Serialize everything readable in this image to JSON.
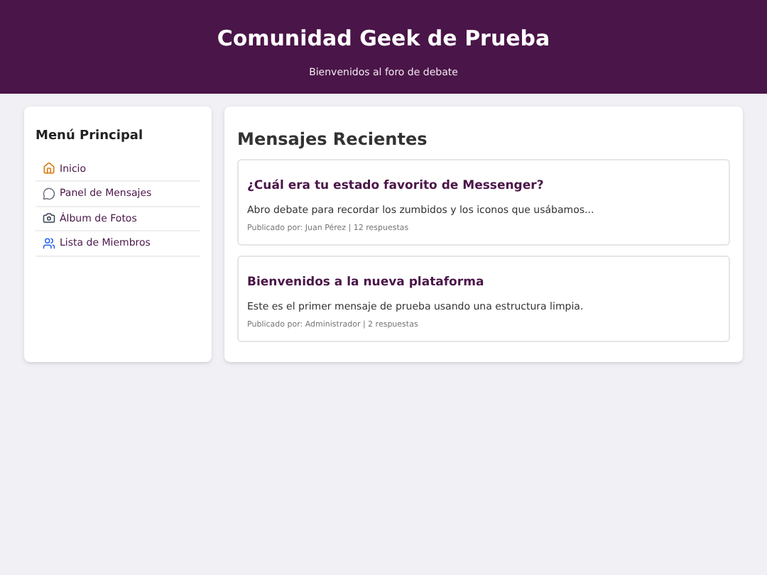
{
  "header": {
    "title": "Comunidad Geek de Prueba",
    "subtitle": "Bienvenidos al foro de debate"
  },
  "sidebar": {
    "title": "Menú Principal",
    "items": [
      {
        "kind": "home",
        "label": "Inicio"
      },
      {
        "kind": "chat",
        "label": "Panel de Mensajes"
      },
      {
        "kind": "camera",
        "label": "Álbum de Fotos"
      },
      {
        "kind": "users",
        "label": "Lista de Miembros"
      }
    ]
  },
  "main": {
    "title": "Mensajes Recientes",
    "posts": [
      {
        "title": "¿Cuál era tu estado favorito de Messenger?",
        "body": "Abro debate para recordar los zumbidos y los iconos que usábamos...",
        "meta": "Publicado por: Juan Pérez | 12 respuestas"
      },
      {
        "title": "Bienvenidos a la nueva plataforma",
        "body": "Este es el primer mensaje de prueba usando una estructura limpia.",
        "meta": "Publicado por: Administrador | 2 respuestas"
      }
    ]
  }
}
